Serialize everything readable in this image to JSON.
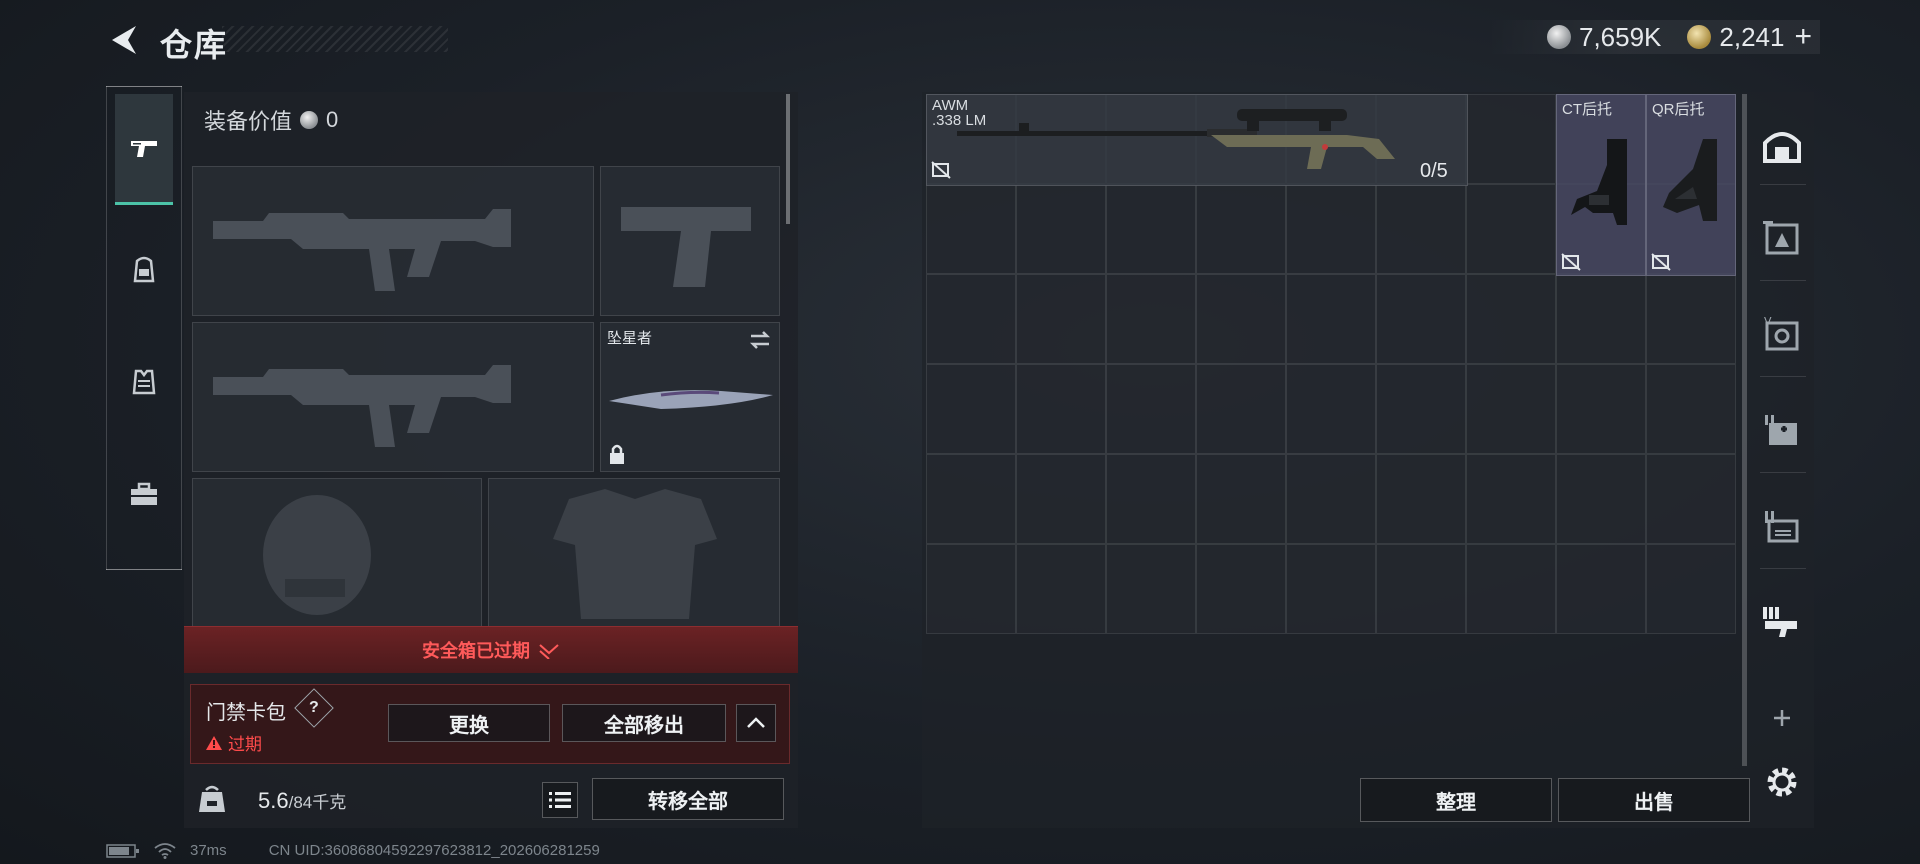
{
  "header": {
    "title": "仓库",
    "currency_silver": "7,659K",
    "currency_gold": "2,241"
  },
  "left_tabs": [
    "weapon",
    "backpack",
    "vest",
    "toolbox"
  ],
  "equip": {
    "value_label": "装备价值",
    "value": "0",
    "melee_name": "坠星者"
  },
  "safebox": {
    "expired_label": "安全箱已过期"
  },
  "card_pack": {
    "title": "门禁卡包",
    "help": "?",
    "status": "过期",
    "replace_label": "更换",
    "move_all_label": "全部移出"
  },
  "footer": {
    "weight_current": "5.6",
    "weight_max": "/84千克",
    "transfer_all_label": "转移全部"
  },
  "status_bar": {
    "ping": "37ms",
    "uid": "CN UID:36086804592297623812_202606281259"
  },
  "storage": {
    "awm_name": "AWM",
    "awm_ammo_type": ".338 LM",
    "awm_ammo": "0/5",
    "stock1_label": "CT后托",
    "stock2_label": "QR后托",
    "sort_label": "整理",
    "sell_label": "出售"
  }
}
